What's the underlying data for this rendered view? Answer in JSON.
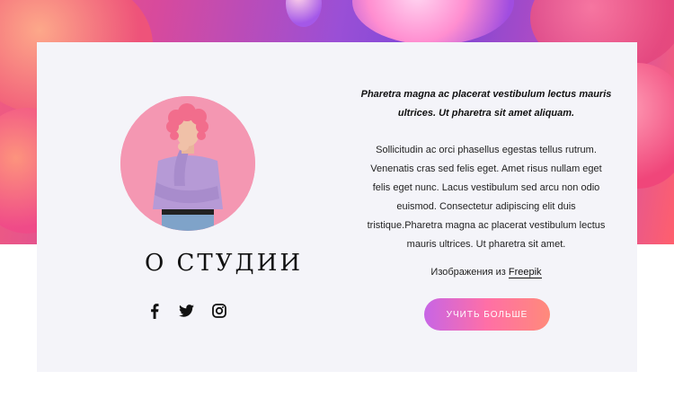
{
  "about": {
    "title": "О СТУДИИ",
    "quote": "Pharetra magna ac placerat vestibulum lectus mauris ultrices. Ut pharetra sit amet aliquam.",
    "body": "Sollicitudin ac orci phasellus egestas tellus rutrum. Venenatis cras sed felis eget. Amet risus nullam eget felis eget nunc. Lacus vestibulum sed arcu non odio euismod. Consectetur adipiscing elit duis tristique.Pharetra magna ac placerat vestibulum lectus mauris ultrices. Ut pharetra sit amet.",
    "credit_prefix": "Изображения из",
    "credit_link": "Freepik",
    "cta_label": "УЧИТЬ БОЛЬШЕ"
  },
  "social": [
    {
      "icon": "facebook-icon"
    },
    {
      "icon": "twitter-icon"
    },
    {
      "icon": "instagram-icon"
    }
  ],
  "colors": {
    "card_bg": "#f4f4f9",
    "cta_start": "#c765e6",
    "cta_end": "#ff8a7a",
    "avatar_bg": "#f497b2"
  }
}
